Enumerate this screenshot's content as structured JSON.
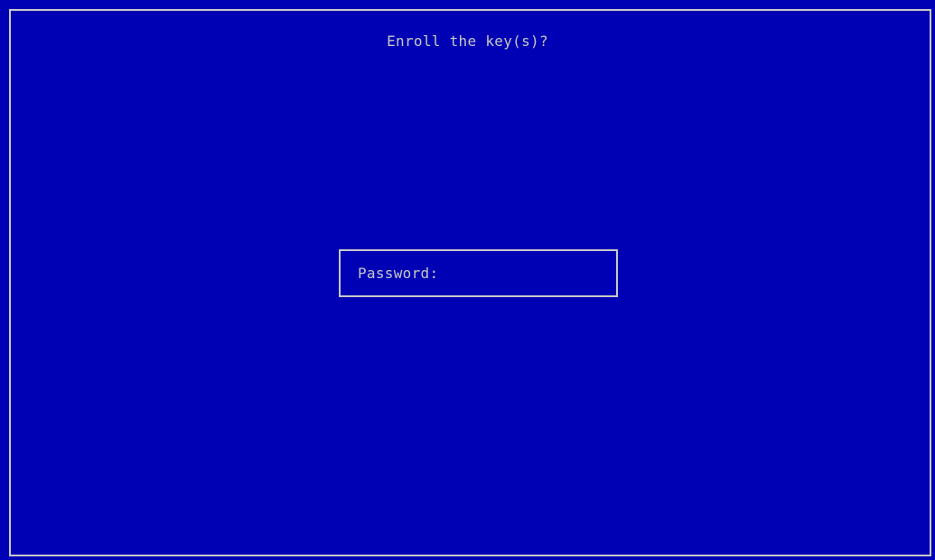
{
  "dialog": {
    "title": "Enroll the key(s)?"
  },
  "password_field": {
    "label": "Password:",
    "value": ""
  },
  "colors": {
    "background": "#0000b4",
    "foreground": "#c8c8c8"
  }
}
